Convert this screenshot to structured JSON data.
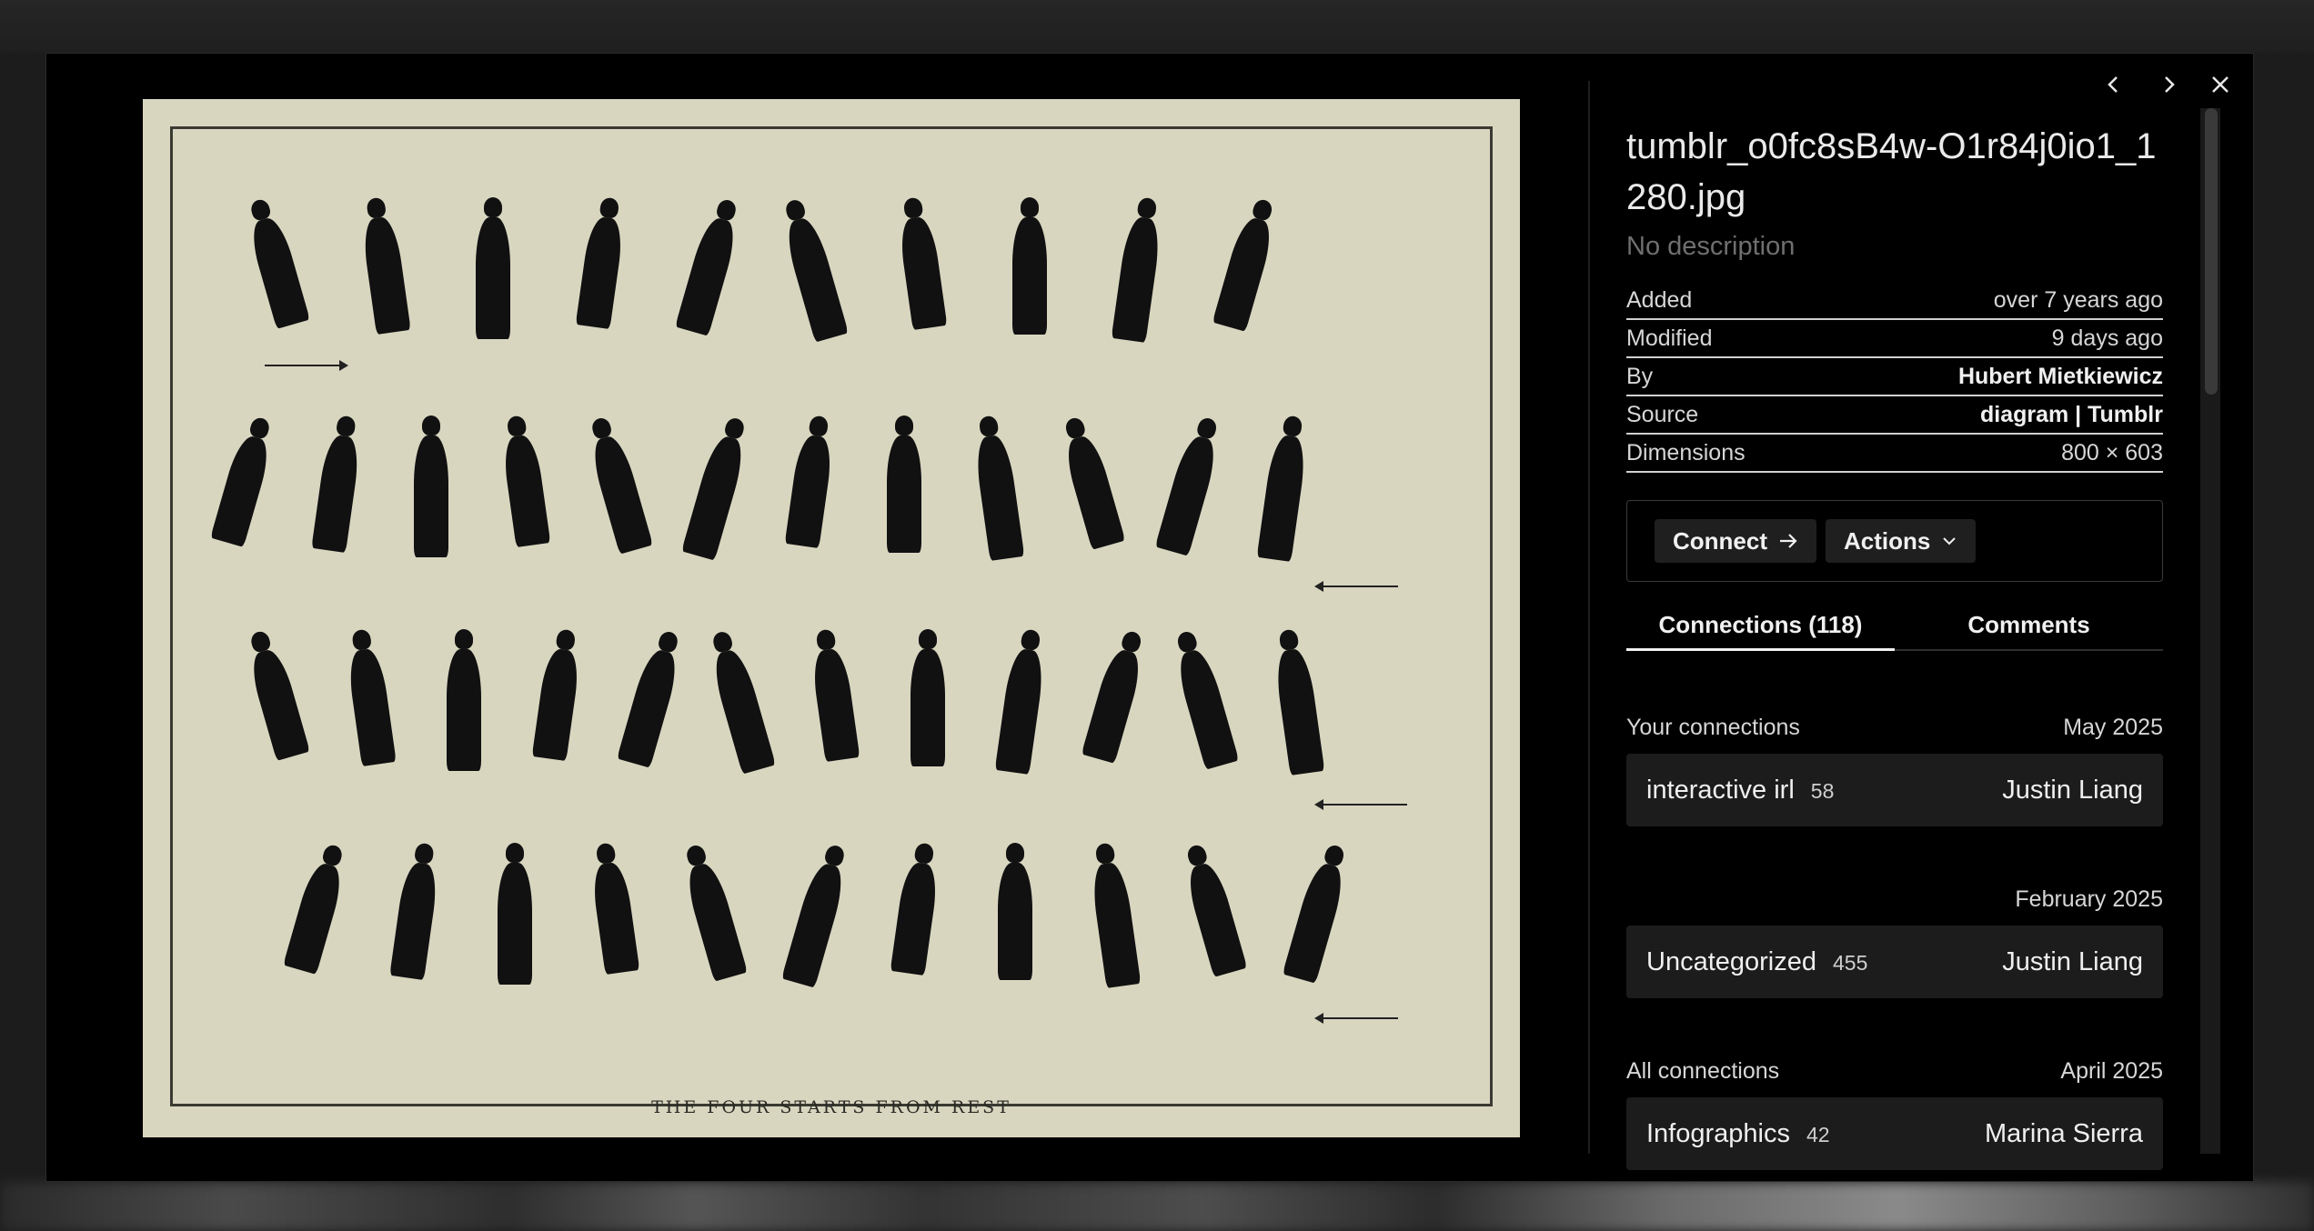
{
  "image": {
    "caption": "THE FOUR STARTS FROM REST"
  },
  "navigation": {
    "prev_icon": "chevron-left-icon",
    "next_icon": "chevron-right-icon",
    "close_icon": "close-icon"
  },
  "panel": {
    "title": "tumblr_o0fc8sB4w-O1r84j0io1_1280.jpg",
    "description": "No description",
    "meta": [
      {
        "key": "Added",
        "value": "over 7 years ago"
      },
      {
        "key": "Modified",
        "value": "9 days ago"
      },
      {
        "key": "By",
        "value": "Hubert Mietkiewicz"
      },
      {
        "key": "Source",
        "value": "diagram | Tumblr"
      },
      {
        "key": "Dimensions",
        "value": "800 × 603"
      }
    ],
    "connect_label": "Connect",
    "actions_label": "Actions",
    "tabs": [
      {
        "label": "Connections (118)"
      },
      {
        "label": "Comments"
      }
    ],
    "sections": [
      {
        "title": "Your connections",
        "date": "May 2025",
        "items": [
          {
            "name": "interactive irl",
            "count": "58",
            "owner": "Justin Liang"
          }
        ]
      },
      {
        "title": "",
        "date": "February 2025",
        "items": [
          {
            "name": "Uncategorized",
            "count": "455",
            "owner": "Justin Liang"
          }
        ]
      },
      {
        "title": "All connections",
        "date": "April 2025",
        "items": [
          {
            "name": "Infographics",
            "count": "42",
            "owner": "Marina Sierra"
          }
        ]
      }
    ]
  },
  "colors": {
    "modal_bg": "#000000",
    "plate_bg": "#d9d6c0",
    "text": "#e8e8e8",
    "muted": "#6f6f6f"
  }
}
